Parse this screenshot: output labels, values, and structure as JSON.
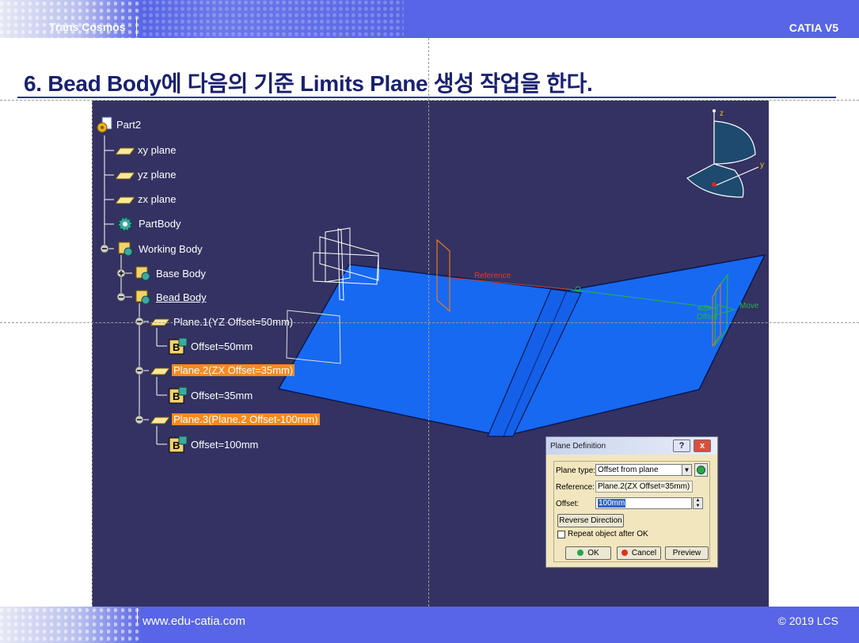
{
  "header": {
    "brand": "Trans Cosmos",
    "product": "CATIA V5"
  },
  "title": "6. Bead Body에 다음의 기준 Limits Plane 생성 작업을 한다.",
  "footer": {
    "url": "www.edu-catia.com",
    "copyright": "© 2019 LCS"
  },
  "tree": {
    "root": "Part2",
    "items": [
      {
        "label": "xy plane",
        "icon": "plane-icon"
      },
      {
        "label": "yz plane",
        "icon": "plane-icon"
      },
      {
        "label": "zx plane",
        "icon": "plane-icon"
      },
      {
        "label": "PartBody",
        "icon": "body-gear-icon"
      },
      {
        "label": "Working Body",
        "icon": "body-icon"
      },
      {
        "label": "Base Body",
        "icon": "body-icon"
      },
      {
        "label": "Bead Body",
        "icon": "body-icon"
      },
      {
        "label": "Plane.1(YZ Offset=50mm)",
        "icon": "plane-icon"
      },
      {
        "label": "Offset=50mm",
        "icon": "parameter-icon"
      },
      {
        "label": "Plane.2(ZX Offset=35mm)",
        "icon": "plane-icon"
      },
      {
        "label": "Offset=35mm",
        "icon": "parameter-icon"
      },
      {
        "label": "Plane.3(Plane.2 Offset-100mm)",
        "icon": "plane-icon"
      },
      {
        "label": "Offset=100mm",
        "icon": "parameter-icon"
      }
    ]
  },
  "viewport": {
    "reference_label": "Reference",
    "offset_label": "Offset",
    "move_label": "Move",
    "axis_z": "z",
    "axis_y": "y",
    "surface_color": "#1565f0",
    "background_color": "#343262",
    "highlight_color": "#f58a1f"
  },
  "dialog": {
    "title": "Plane Definition",
    "help": "?",
    "close": "x",
    "plane_type_label": "Plane type:",
    "plane_type_value": "Offset from plane",
    "reference_label": "Reference:",
    "reference_value": "Plane.2(ZX Offset=35mm)",
    "offset_label": "Offset:",
    "offset_value": "100mm",
    "reverse_button": "Reverse Direction",
    "repeat_label": "Repeat object after OK",
    "ok_button": "OK",
    "cancel_button": "Cancel",
    "preview_button": "Preview"
  }
}
